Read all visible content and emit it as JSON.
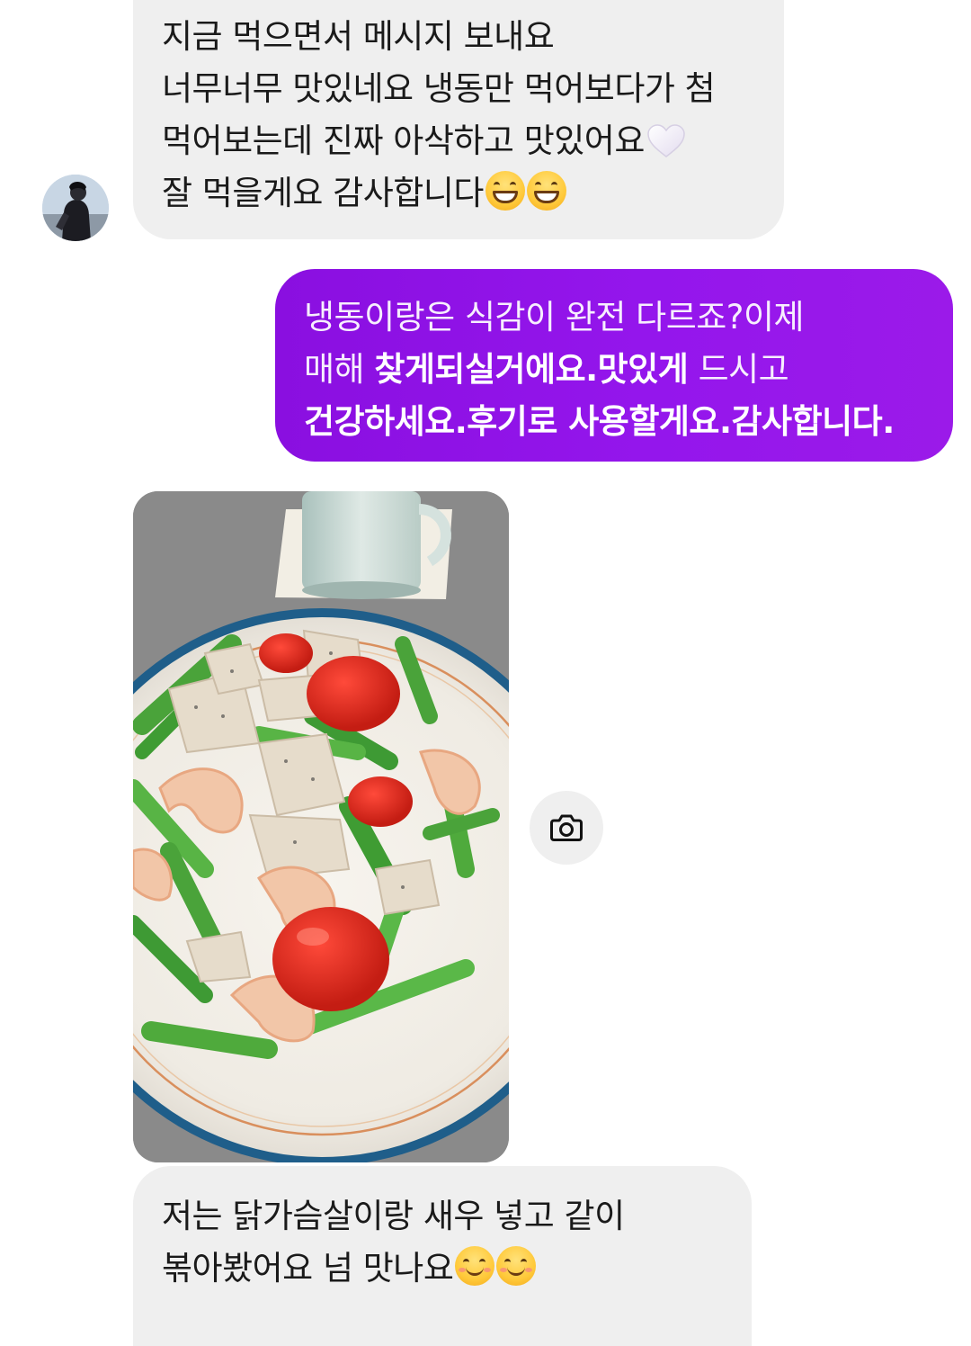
{
  "conversation": {
    "messages": [
      {
        "sender": "received",
        "lines": [
          "지금 먹으면서 메시지 보내요",
          "너무너무 맛있네요 냉동만 먹어보다가 첨",
          "먹어보는데 진짜 아삭하고 맛있어요",
          "잘 먹을게요 감사합니다"
        ]
      },
      {
        "sender": "sent",
        "lines": [
          {
            "normal": "냉동이랑은 식감이 완전 다르죠?이제",
            "bold": ""
          },
          {
            "normal": "매해 ",
            "bold": "찾게되실거에요.맛있게",
            "tail": " 드시고"
          },
          {
            "bold": "건강하세요.후기로 사용할게요.감사합니다."
          }
        ]
      },
      {
        "sender": "received",
        "type": "photo",
        "photo_description_icon": "camera-icon"
      },
      {
        "sender": "received",
        "lines": [
          "저는 닭가슴살이랑 새우 넣고 같이",
          "볶아봤어요 넘 맛나요"
        ]
      }
    ]
  },
  "colors": {
    "sent_bubble": "#9416ec",
    "received_bubble": "#efefef",
    "received_text": "#1a1a1a",
    "sent_text": "#ffffff"
  },
  "icons": {
    "heart": "white-heart-emoji",
    "grin": "grinning-face-emoji",
    "smile": "smiling-face-emoji",
    "camera": "camera-icon"
  }
}
